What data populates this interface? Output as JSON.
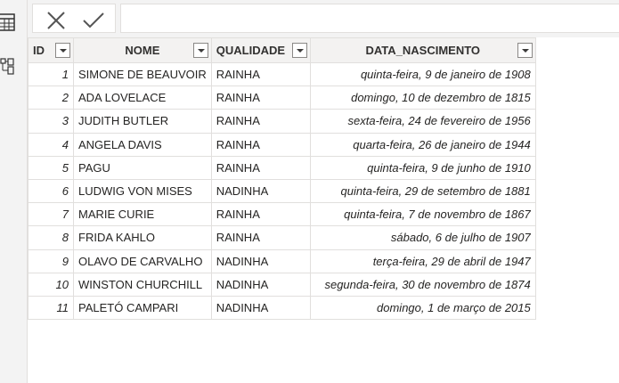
{
  "toolbar": {
    "cancel_icon": "close-icon",
    "commit_icon": "check-icon"
  },
  "table": {
    "columns": [
      "ID",
      "NOME",
      "QUALIDADE",
      "DATA_NASCIMENTO"
    ],
    "rows": [
      [
        "1",
        "SIMONE DE BEAUVOIR",
        "RAINHA",
        "quinta-feira, 9 de janeiro de 1908"
      ],
      [
        "2",
        "ADA LOVELACE",
        "RAINHA",
        "domingo, 10 de dezembro de 1815"
      ],
      [
        "3",
        "JUDITH BUTLER",
        "RAINHA",
        "sexta-feira, 24 de fevereiro de 1956"
      ],
      [
        "4",
        "ANGELA DAVIS",
        "RAINHA",
        "quarta-feira, 26 de janeiro de 1944"
      ],
      [
        "5",
        "PAGU",
        "RAINHA",
        "quinta-feira, 9 de junho de 1910"
      ],
      [
        "6",
        "LUDWIG VON MISES",
        "NADINHA",
        "quinta-feira, 29 de setembro de 1881"
      ],
      [
        "7",
        "MARIE CURIE",
        "RAINHA",
        "quinta-feira, 7 de novembro de 1867"
      ],
      [
        "8",
        "FRIDA KAHLO",
        "RAINHA",
        "sábado, 6 de julho de 1907"
      ],
      [
        "9",
        "OLAVO DE CARVALHO",
        "NADINHA",
        "terça-feira, 29 de abril de 1947"
      ],
      [
        "10",
        "WINSTON CHURCHILL",
        "NADINHA",
        "segunda-feira, 30 de novembro de 1874"
      ],
      [
        "11",
        "PALETÓ CAMPARI",
        "NADINHA",
        "domingo, 1 de março de 2015"
      ]
    ]
  }
}
